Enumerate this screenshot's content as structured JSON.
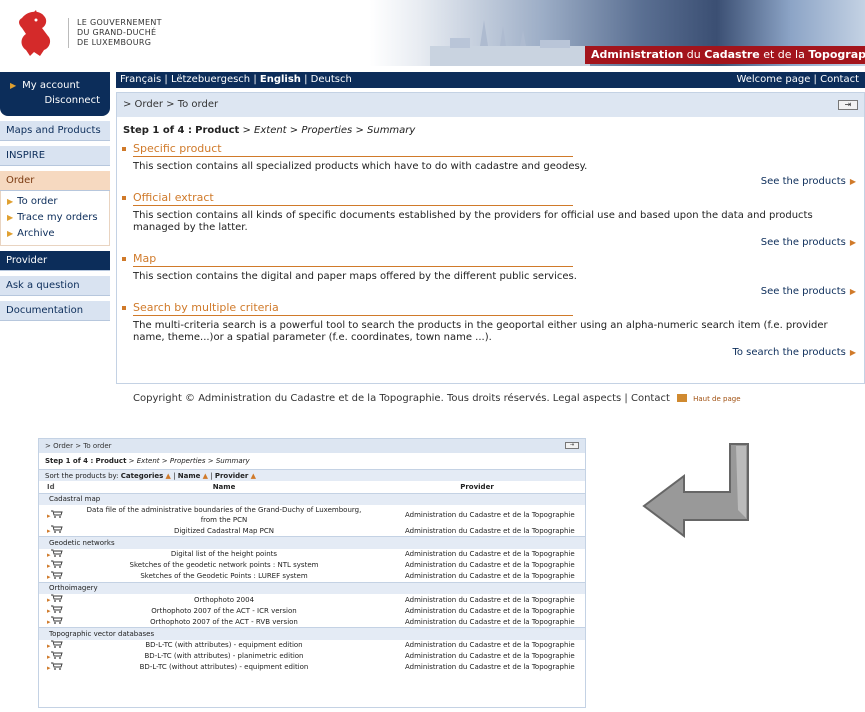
{
  "header": {
    "gov_lines": [
      "LE GOUVERNEMENT",
      "DU GRAND-DUCHÉ",
      "DE LUXEMBOURG"
    ],
    "banner_title_part1": "Administration",
    "banner_title_part2": " du ",
    "banner_title_part3": "Cadastre",
    "banner_title_part4": " et de la ",
    "banner_title_part5": "Topographie"
  },
  "sidebar": {
    "my_account": "My account",
    "disconnect": "Disconnect",
    "items": {
      "maps": "Maps and Products",
      "inspire": "INSPIRE",
      "order": "Order",
      "provider": "Provider",
      "ask": "Ask a question",
      "documentation": "Documentation"
    },
    "order_sub": [
      "To order",
      "Trace my orders",
      "Archive"
    ]
  },
  "topnav": {
    "lang_fr": "Français",
    "lang_lb": "Lëtzebuergesch",
    "lang_en": "English",
    "lang_de": "Deutsch",
    "sep": " | ",
    "welcome": "Welcome page",
    "contact": "Contact"
  },
  "main": {
    "breadcrumb": "> Order > To order",
    "step_prefix": "Step 1 of 4 :",
    "step_current": "Product",
    "step_rest": " > Extent > Properties > Summary",
    "sections": [
      {
        "title": "Specific product",
        "desc": "This section contains all specialized products which have to do with cadastre and geodesy.",
        "link": "See the products"
      },
      {
        "title": "Official extract",
        "desc": "This section contains all kinds of specific documents established by the providers for official use and based upon the data and products managed by the latter.",
        "link": "See the products"
      },
      {
        "title": "Map",
        "desc": "This section contains the digital and paper maps offered by the different public services.",
        "link": "See the products"
      },
      {
        "title": "Search by multiple criteria",
        "desc": "The multi-criteria search is a powerful tool to search the products in the geoportal either using an alpha-numeric search item (f.e. provider name, theme...)or a spatial parameter (f.e. coordinates, town name ...).",
        "link": "To search the products"
      }
    ]
  },
  "footer": {
    "text": "Copyright © Administration du Cadastre et de la Topographie. Tous droits réservés. Legal aspects | Contact",
    "haut": "Haut de page"
  },
  "inset": {
    "breadcrumb": "> Order > To order",
    "step_prefix": "Step 1 of 4 :",
    "step_current": "Product",
    "step_rest": " > Extent > Properties > Summary",
    "sort_label": "Sort the products by:",
    "sort_categories": "Categories",
    "sort_name": "Name",
    "sort_provider": "Provider",
    "col_id": "Id",
    "col_name": "Name",
    "col_provider": "Provider",
    "groups": [
      {
        "category": "Cadastral map",
        "rows": [
          {
            "name": "Data file of the administrative boundaries of the Grand-Duchy of Luxembourg, from the PCN",
            "provider": "Administration du Cadastre et de la Topographie"
          },
          {
            "name": "Digitized Cadastral Map PCN",
            "provider": "Administration du Cadastre et de la Topographie"
          }
        ]
      },
      {
        "category": "Geodetic networks",
        "rows": [
          {
            "name": "Digital list of the height points",
            "provider": "Administration du Cadastre et de la Topographie"
          },
          {
            "name": "Sketches of the geodetic network points : NTL system",
            "provider": "Administration du Cadastre et de la Topographie"
          },
          {
            "name": "Sketches of the Geodetic Points : LUREF system",
            "provider": "Administration du Cadastre et de la Topographie"
          }
        ]
      },
      {
        "category": "Orthoimagery",
        "rows": [
          {
            "name": "Orthophoto 2004",
            "provider": "Administration du Cadastre et de la Topographie"
          },
          {
            "name": "Orthophoto 2007 of the ACT - ICR version",
            "provider": "Administration du Cadastre et de la Topographie"
          },
          {
            "name": "Orthophoto 2007 of the ACT - RVB version",
            "provider": "Administration du Cadastre et de la Topographie"
          }
        ]
      },
      {
        "category": "Topographic vector databases",
        "rows": [
          {
            "name": "BD-L-TC (with attributes) - equipment edition",
            "provider": "Administration du Cadastre et de la Topographie"
          },
          {
            "name": "BD-L-TC (with attributes) - planimetric edition",
            "provider": "Administration du Cadastre et de la Topographie"
          },
          {
            "name": "BD-L-TC (without attributes) - equipment edition",
            "provider": "Administration du Cadastre et de la Topographie"
          }
        ]
      }
    ]
  },
  "colors": {
    "navy": "#0c2d5a",
    "accent": "#d07a2a",
    "banner_red": "#a3141c",
    "light_blue": "#dde6f2"
  }
}
